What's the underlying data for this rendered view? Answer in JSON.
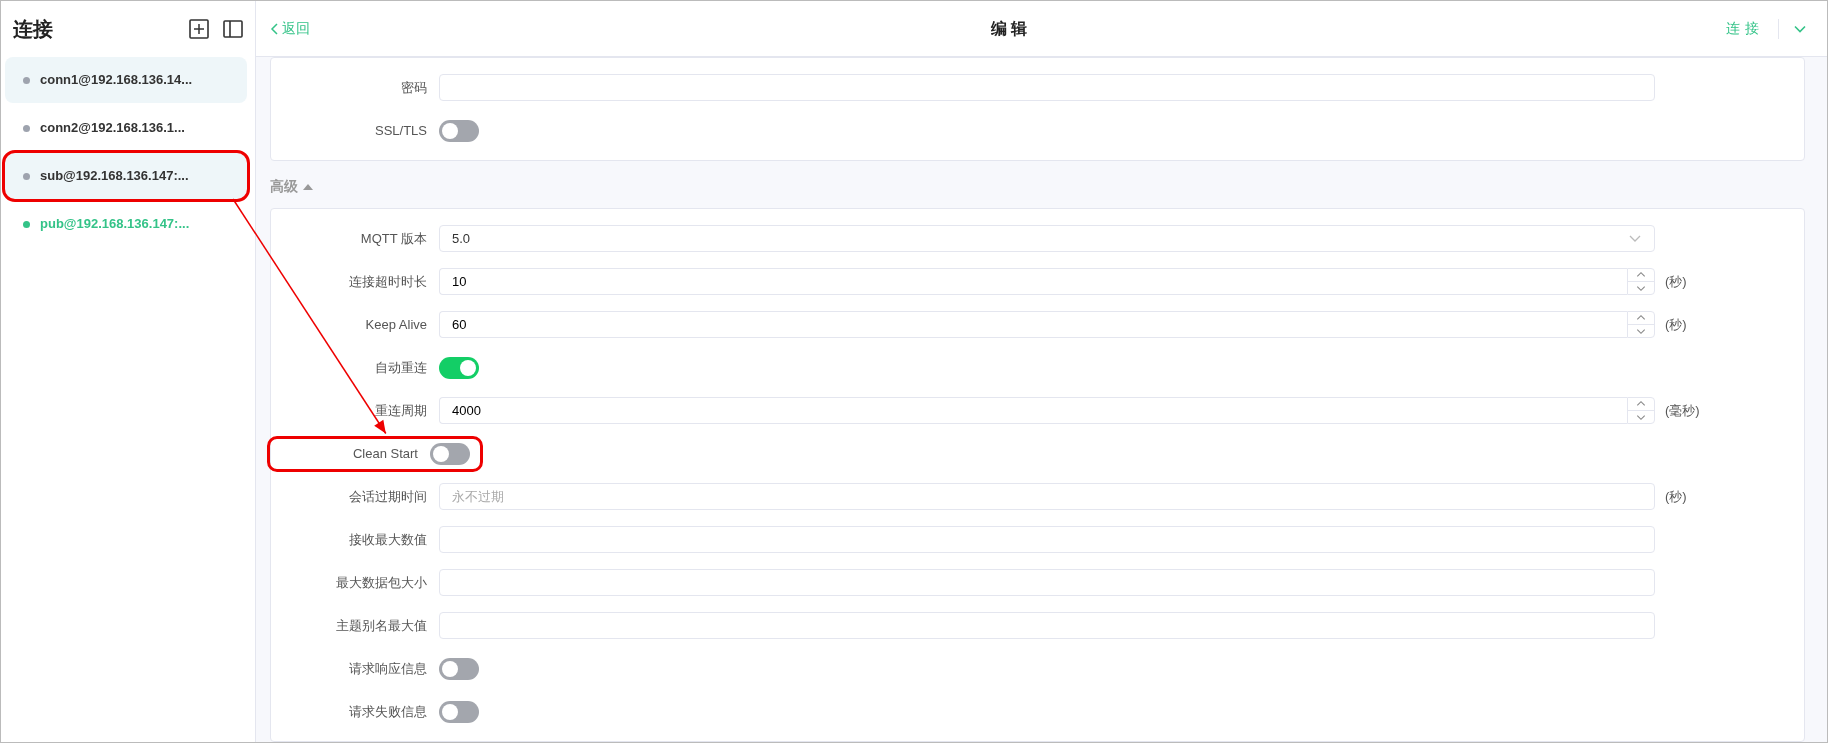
{
  "sidebar": {
    "title": "连接",
    "items": [
      {
        "label": "conn1@192.168.136.14...",
        "connected": false,
        "shaded": true,
        "annotated": false
      },
      {
        "label": "conn2@192.168.136.1...",
        "connected": false,
        "shaded": false,
        "annotated": false
      },
      {
        "label": "sub@192.168.136.147:...",
        "connected": false,
        "shaded": true,
        "annotated": true
      },
      {
        "label": "pub@192.168.136.147:...",
        "connected": true,
        "shaded": false,
        "annotated": false
      }
    ]
  },
  "header": {
    "back": "返回",
    "title": "编辑",
    "connect": "连接"
  },
  "basic": {
    "fields": [
      {
        "kind": "text",
        "label": "密码",
        "annotated": false
      },
      {
        "kind": "switch",
        "label": "SSL/TLS",
        "on": false,
        "annotated": false
      }
    ]
  },
  "advanced": {
    "title": "高级",
    "expanded": true,
    "fields": [
      {
        "kind": "select",
        "label": "MQTT 版本",
        "value": "5.0",
        "annotated": false
      },
      {
        "kind": "number",
        "label": "连接超时时长",
        "value": "10",
        "unit": "(秒)",
        "annotated": false
      },
      {
        "kind": "number",
        "label": "Keep Alive",
        "value": "60",
        "unit": "(秒)",
        "annotated": false
      },
      {
        "kind": "switch",
        "label": "自动重连",
        "on": true,
        "annotated": false
      },
      {
        "kind": "number",
        "label": "重连周期",
        "value": "4000",
        "unit": "(毫秒)",
        "annotated": false
      },
      {
        "kind": "switch",
        "label": "Clean Start",
        "on": false,
        "annotated": true
      },
      {
        "kind": "text",
        "label": "会话过期时间",
        "placeholder": "永不过期",
        "unit": "(秒)",
        "annotated": false
      },
      {
        "kind": "text",
        "label": "接收最大数值",
        "annotated": false
      },
      {
        "kind": "text",
        "label": "最大数据包大小",
        "annotated": false
      },
      {
        "kind": "text",
        "label": "主题别名最大值",
        "annotated": false
      },
      {
        "kind": "switch",
        "label": "请求响应信息",
        "on": false,
        "annotated": false
      },
      {
        "kind": "switch",
        "label": "请求失败信息",
        "on": false,
        "annotated": false
      }
    ]
  }
}
